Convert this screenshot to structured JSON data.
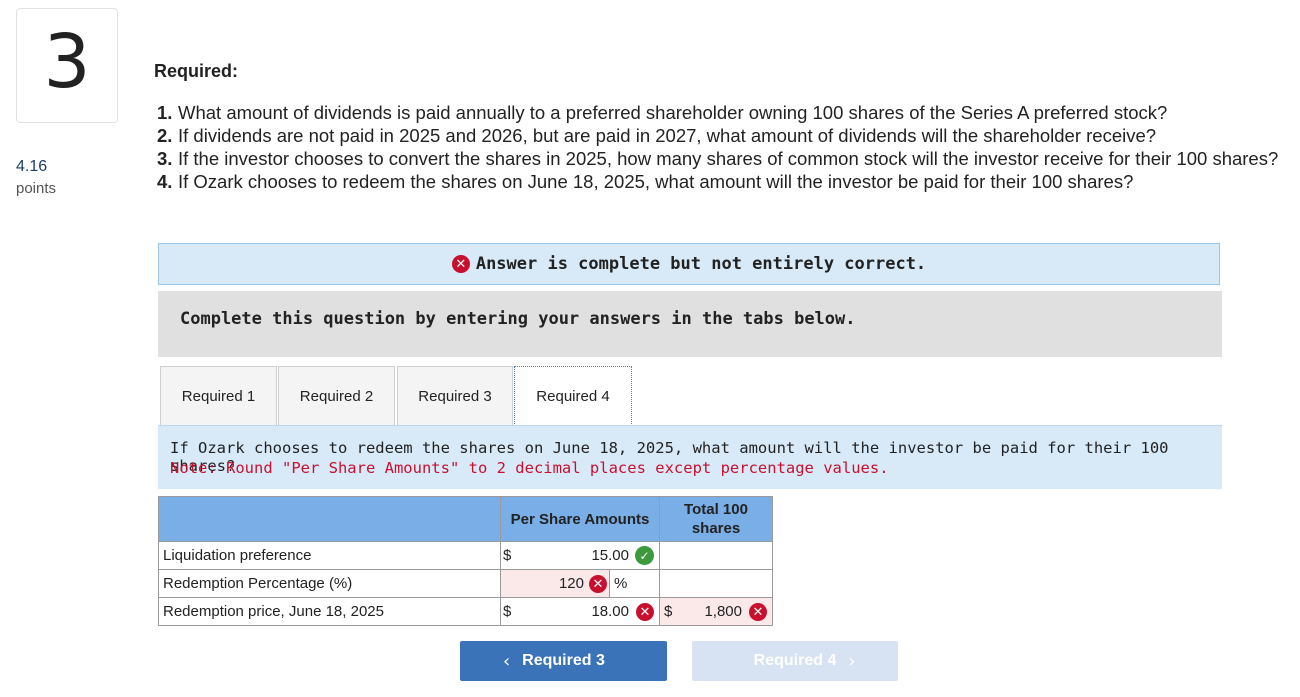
{
  "question": {
    "number": "3",
    "points_value": "4.16",
    "points_label": "points"
  },
  "required_heading": "Required:",
  "questions": [
    {
      "num": "1.",
      "text": "What amount of dividends is paid annually to a preferred shareholder owning 100 shares of the Series A preferred stock?"
    },
    {
      "num": "2.",
      "text": "If dividends are not paid in 2025 and 2026, but are paid in 2027, what amount of dividends will the shareholder receive?"
    },
    {
      "num": "3.",
      "text": "If the investor chooses to convert the shares in 2025, how many shares of common stock will the investor receive for their 100 shares?"
    },
    {
      "num": "4.",
      "text": "If Ozark chooses to redeem the shares on June 18, 2025, what amount will the investor be paid for their 100 shares?"
    }
  ],
  "banner": {
    "text": "Answer is complete but not entirely correct."
  },
  "instructions": "Complete this question by entering your answers in the tabs below.",
  "tabs": [
    "Required 1",
    "Required 2",
    "Required 3",
    "Required 4"
  ],
  "active_tab": "Required 4",
  "prompt": {
    "question": "If Ozark chooses to redeem the shares on June 18, 2025, what amount will the investor be paid for their 100 shares?",
    "note": "Note: Round \"Per Share Amounts\" to 2 decimal places except percentage values."
  },
  "table": {
    "headers": [
      "Per Share Amounts",
      "Total 100 shares"
    ],
    "rows": [
      {
        "label": "Liquidation preference",
        "currency": "$",
        "per_share": "15.00",
        "per_share_status": "correct"
      },
      {
        "label": "Redemption Percentage (%)",
        "per_share": "120",
        "per_share_status": "incorrect",
        "unit": "%"
      },
      {
        "label": "Redemption price, June 18, 2025",
        "currency": "$",
        "per_share": "18.00",
        "per_share_status": "incorrect",
        "total_currency": "$",
        "total": "1,800",
        "total_status": "incorrect"
      }
    ]
  },
  "nav": {
    "prev_label": "Required 3",
    "next_label": "Required 4"
  },
  "colors": {
    "accent": "#3a73b8",
    "error": "#c8102e",
    "success": "#3c9a3c",
    "banner_bg": "#d8eaf8",
    "header_bg": "#7aaee6"
  }
}
